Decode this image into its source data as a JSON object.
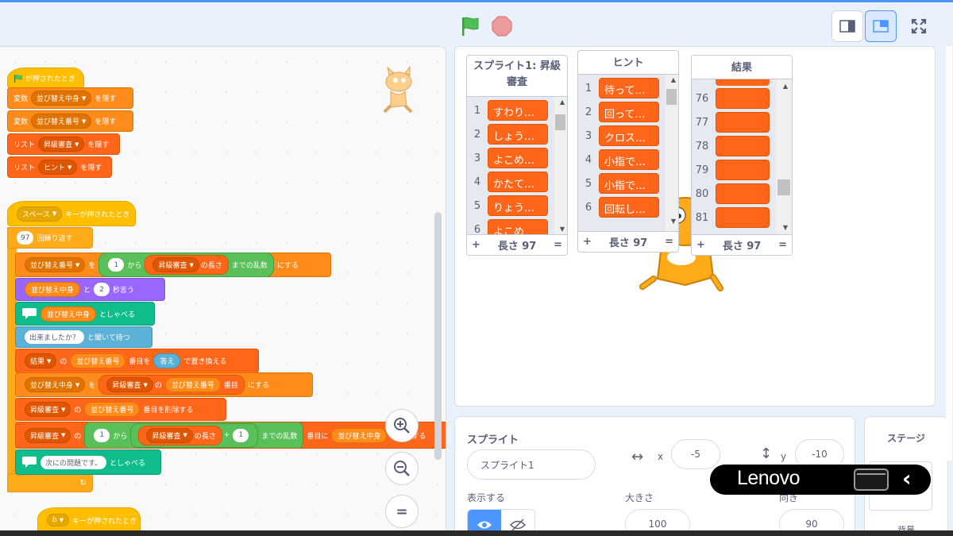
{
  "toolbar": {
    "green_flag_icon": "green-flag-icon",
    "stop_icon": "stop-icon"
  },
  "script": {
    "hat1": {
      "label": "が押されたとき"
    },
    "b_var1": {
      "prefix": "変数",
      "dropdown": "並び替え中身",
      "suffix": "を隠す"
    },
    "b_var2": {
      "prefix": "変数",
      "dropdown": "並び替え番号",
      "suffix": "を隠す"
    },
    "b_lst1": {
      "prefix": "リスト",
      "dropdown": "昇級審査",
      "suffix": "を隠す"
    },
    "b_lst2": {
      "prefix": "リスト",
      "dropdown": "ヒント",
      "suffix": "を隠す"
    },
    "hat2": {
      "key": "スペース",
      "suffix": "キーが押されたとき"
    },
    "repeat": {
      "count": "97",
      "label": "回繰り返す"
    },
    "set1": {
      "var": "並び替え番号",
      "to": "を",
      "from_num": "1",
      "from": "から",
      "list": "昇級審査",
      "length": "の長さ",
      "rand": "までの乱数",
      "suffix": "にする"
    },
    "say2": {
      "var": "並び替え中身",
      "and": "と",
      "secs": "2",
      "label": "秒言う"
    },
    "speak1": {
      "var": "並び替え中身",
      "label": "としゃべる"
    },
    "ask": {
      "text": "出来ましたか？",
      "label": "と聞いて待つ"
    },
    "replace": {
      "list": "結果",
      "of": "の",
      "var": "並び替え番号",
      "item": "番目を",
      "answer": "答え",
      "label": "で置き換える"
    },
    "set2": {
      "var": "並び替え中身",
      "to": "を",
      "list": "昇級審査",
      "of": "の",
      "idx": "並び替え番号",
      "item": "番目",
      "suffix": "にする"
    },
    "delete": {
      "list": "昇級審査",
      "of": "の",
      "idx": "並び替え番号",
      "label": "番目を削除する"
    },
    "insert": {
      "list": "昇級審査",
      "of": "の",
      "from_num": "1",
      "from": "から",
      "list2": "昇級審査",
      "length": "の長さ",
      "plus": "+",
      "plus_num": "1",
      "rand": "までの乱数",
      "at": "番目に",
      "var": "並び替え中身",
      "label": "を挿入する"
    },
    "speak2": {
      "text": "次にの問題です。",
      "label": "としゃべる"
    },
    "hat3": {
      "key": "b",
      "suffix": "キーが押されたとき"
    }
  },
  "zoom": {
    "in_icon": "zoom-in-icon",
    "out_icon": "zoom-out-icon",
    "reset_icon": "zoom-reset-icon",
    "reset_label": "="
  },
  "monitors": [
    {
      "title": "スプライト1: 昇級審査",
      "rows": [
        {
          "index": "1",
          "value": "すわり…"
        },
        {
          "index": "2",
          "value": "しょう…"
        },
        {
          "index": "3",
          "value": "よこめ…"
        },
        {
          "index": "4",
          "value": "かたて…"
        },
        {
          "index": "5",
          "value": "りょう…"
        },
        {
          "index": "6",
          "value": "よこめ"
        }
      ],
      "add": "+",
      "length": "長さ 97",
      "eq": "="
    },
    {
      "title": "ヒント",
      "rows": [
        {
          "index": "1",
          "value": "待って…"
        },
        {
          "index": "2",
          "value": "回って…"
        },
        {
          "index": "3",
          "value": "クロス…"
        },
        {
          "index": "4",
          "value": "小指で…"
        },
        {
          "index": "5",
          "value": "小指で…"
        },
        {
          "index": "6",
          "value": "回転し…"
        }
      ],
      "add": "+",
      "length": "長さ 97",
      "eq": "="
    },
    {
      "title": "結果",
      "rows": [
        {
          "index": "76",
          "value": ""
        },
        {
          "index": "77",
          "value": ""
        },
        {
          "index": "78",
          "value": ""
        },
        {
          "index": "79",
          "value": ""
        },
        {
          "index": "80",
          "value": ""
        },
        {
          "index": "81",
          "value": ""
        }
      ],
      "add": "+",
      "length": "長さ 97",
      "eq": "="
    }
  ],
  "sprite_info": {
    "heading": "スプライト",
    "name": "スプライト1",
    "x_label": "x",
    "x_value": "-5",
    "y_label": "y",
    "y_value": "-10",
    "show_label": "表示する",
    "size_label": "大きさ",
    "size_value": "100",
    "direction_label": "向き",
    "direction_value": "90"
  },
  "stage_panel": {
    "heading": "ステージ",
    "backdrop_label": "背景"
  },
  "overlay": {
    "brand": "Lenovo",
    "chevron": "‹"
  },
  "colors": {
    "events": "#ffbf00",
    "variables": "#ff8c1a",
    "lists": "#ff661a",
    "control": "#ffab19",
    "operators": "#59c059",
    "looks": "#9966ff",
    "text2speech": "#0fbd8c",
    "sensing": "#5cb1d6",
    "accent": "#4c97ff"
  }
}
